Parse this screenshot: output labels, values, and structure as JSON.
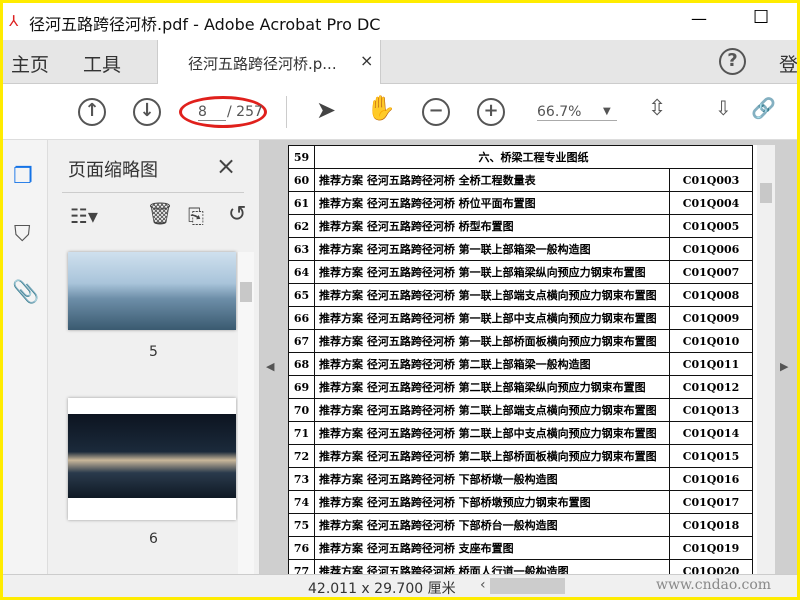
{
  "window": {
    "title": "径河五路跨径河桥.pdf - Adobe Acrobat Pro DC",
    "minimize": "—",
    "maximize": "☐"
  },
  "tabs": {
    "home": "主页",
    "tools": "工具",
    "document": "径河五路跨径河桥.p...",
    "close": "×",
    "help": "?",
    "signin": "登"
  },
  "toolbar": {
    "current_page": "8",
    "total_pages": "/ 257",
    "zoom": "66.7%"
  },
  "panel": {
    "title": "页面缩略图",
    "close": "×",
    "thumbnails": [
      {
        "label": "5"
      },
      {
        "label": "6"
      }
    ]
  },
  "table": {
    "rows": [
      {
        "n": "59",
        "desc": "六、桥梁工程专业图纸",
        "code": "",
        "heading": true
      },
      {
        "n": "60",
        "desc": "推荐方案 径河五路跨径河桥 全桥工程数量表",
        "code": "C01Q003"
      },
      {
        "n": "61",
        "desc": "推荐方案 径河五路跨径河桥 桥位平面布置图",
        "code": "C01Q004"
      },
      {
        "n": "62",
        "desc": "推荐方案 径河五路跨径河桥 桥型布置图",
        "code": "C01Q005"
      },
      {
        "n": "63",
        "desc": "推荐方案 径河五路跨径河桥 第一联上部箱梁一般构造图",
        "code": "C01Q006"
      },
      {
        "n": "64",
        "desc": "推荐方案 径河五路跨径河桥 第一联上部箱梁纵向预应力钢束布置图",
        "code": "C01Q007"
      },
      {
        "n": "65",
        "desc": "推荐方案 径河五路跨径河桥 第一联上部端支点横向预应力钢束布置图",
        "code": "C01Q008"
      },
      {
        "n": "66",
        "desc": "推荐方案 径河五路跨径河桥 第一联上部中支点横向预应力钢束布置图",
        "code": "C01Q009"
      },
      {
        "n": "67",
        "desc": "推荐方案 径河五路跨径河桥 第一联上部桥面板横向预应力钢束布置图",
        "code": "C01Q010"
      },
      {
        "n": "68",
        "desc": "推荐方案 径河五路跨径河桥 第二联上部箱梁一般构造图",
        "code": "C01Q011"
      },
      {
        "n": "69",
        "desc": "推荐方案 径河五路跨径河桥 第二联上部箱梁纵向预应力钢束布置图",
        "code": "C01Q012"
      },
      {
        "n": "70",
        "desc": "推荐方案 径河五路跨径河桥 第二联上部端支点横向预应力钢束布置图",
        "code": "C01Q013"
      },
      {
        "n": "71",
        "desc": "推荐方案 径河五路跨径河桥 第二联上部中支点横向预应力钢束布置图",
        "code": "C01Q014"
      },
      {
        "n": "72",
        "desc": "推荐方案 径河五路跨径河桥 第二联上部桥面板横向预应力钢束布置图",
        "code": "C01Q015"
      },
      {
        "n": "73",
        "desc": "推荐方案 径河五路跨径河桥 下部桥墩一般构造图",
        "code": "C01Q016"
      },
      {
        "n": "74",
        "desc": "推荐方案 径河五路跨径河桥 下部桥墩预应力钢束布置图",
        "code": "C01Q017"
      },
      {
        "n": "75",
        "desc": "推荐方案 径河五路跨径河桥 下部桥台一般构造图",
        "code": "C01Q018"
      },
      {
        "n": "76",
        "desc": "推荐方案 径河五路跨径河桥 支座布置图",
        "code": "C01Q019"
      },
      {
        "n": "77",
        "desc": "推荐方案 径河五路跨径河桥 桥面人行道一般构造图",
        "code": "C01Q020"
      }
    ]
  },
  "status": {
    "page_size": "42.011 x 29.700 厘米",
    "watermark": "www.cndao.com"
  },
  "colors": {
    "accent": "#1473e6",
    "highlight_circle": "#e0201c",
    "frame": "#ffec00"
  }
}
